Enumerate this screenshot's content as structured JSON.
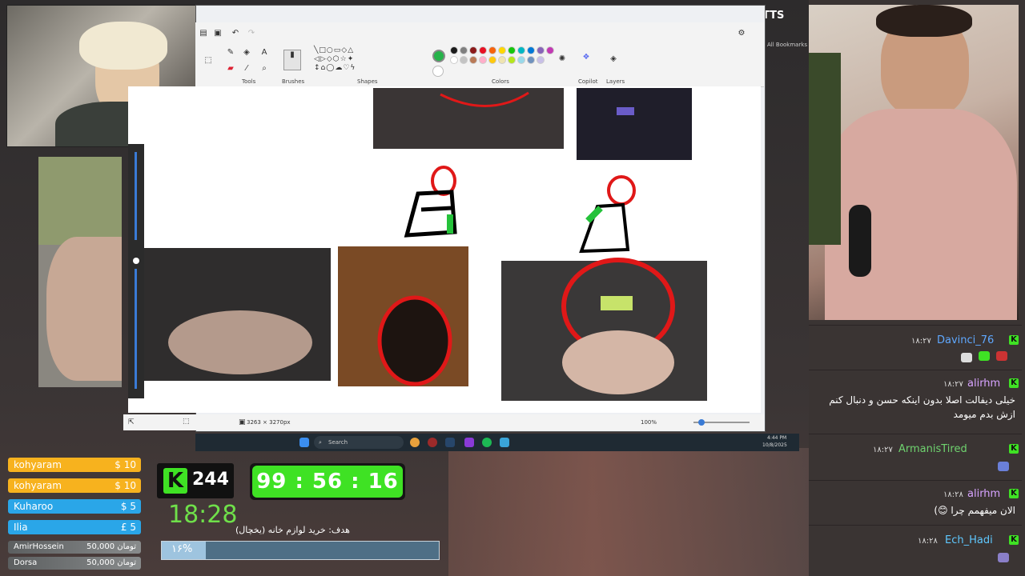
{
  "browser": {
    "tts_label": "TTS",
    "bookmarks_label": "All Bookmarks"
  },
  "paint": {
    "groups": {
      "tools": "Tools",
      "brushes": "Brushes",
      "shapes": "Shapes",
      "colors": "Colors",
      "copilot": "Copilot",
      "layers": "Layers"
    },
    "status": {
      "dimensions": "3263 × 3270px",
      "zoom": "100%"
    },
    "colors": [
      "#26b34a",
      "#1a1a1a",
      "#7f7f7f",
      "#8b1a1a",
      "#e81123",
      "#f7630c",
      "#ffd700",
      "#16c60c",
      "#00b7c3",
      "#0078d7",
      "#8764b8",
      "#c239b3",
      "#ffffff",
      "#c3c3c3",
      "#b97a57",
      "#ffaec9",
      "#ffc90e",
      "#efe4b0",
      "#b5e61d",
      "#99d9ea",
      "#7092be",
      "#c8bfe7"
    ]
  },
  "taskbar": {
    "search_placeholder": "Search",
    "time": "4:44 PM",
    "date": "10/8/2025"
  },
  "overlay": {
    "donations": [
      {
        "name": "kohyaram",
        "amount": "$ 10",
        "color": "#f7b21e"
      },
      {
        "name": "kohyaram",
        "amount": "$ 10",
        "color": "#f7b21e"
      },
      {
        "name": "Kuharoo",
        "amount": "$ 5",
        "color": "#2aa6e8"
      },
      {
        "name": "Ilia",
        "amount": "£ 5",
        "color": "#2aa6e8"
      },
      {
        "name": "AmirHossein",
        "amount": "50,000 تومان"
      },
      {
        "name": "Dorsa",
        "amount": "50,000 تومان"
      }
    ],
    "kick_logo": "K",
    "viewers": "244",
    "timer": "99 : 56 : 16",
    "clock": "18:28",
    "goal_text": "هدف: خرید لوازم خانه (یخچال)",
    "goal_percent_label": "۱۶%",
    "goal_progress": 0.16
  },
  "chat": {
    "messages": [
      {
        "time": "۱۸:۲۷",
        "user": "Davinci_76",
        "user_color": "#5fa8ff",
        "text": ""
      },
      {
        "time": "۱۸:۲۷",
        "user": "alirhm",
        "user_color": "#d7a3ff",
        "text": "خیلی دیفالت اصلا بدون اینکه حسن و دنبال کنم ازش بدم میومد"
      },
      {
        "time": "۱۸:۲۷",
        "user": "ArmanisTired",
        "user_color": "#6fd36f",
        "text": ""
      },
      {
        "time": "۱۸:۲۸",
        "user": "alirhm",
        "user_color": "#d7a3ff",
        "text": "الان میفهمم چرا 😊)"
      },
      {
        "time": "۱۸:۲۸",
        "user": "Ech_Hadi",
        "user_color": "#5fc8ff",
        "text": ""
      }
    ]
  }
}
